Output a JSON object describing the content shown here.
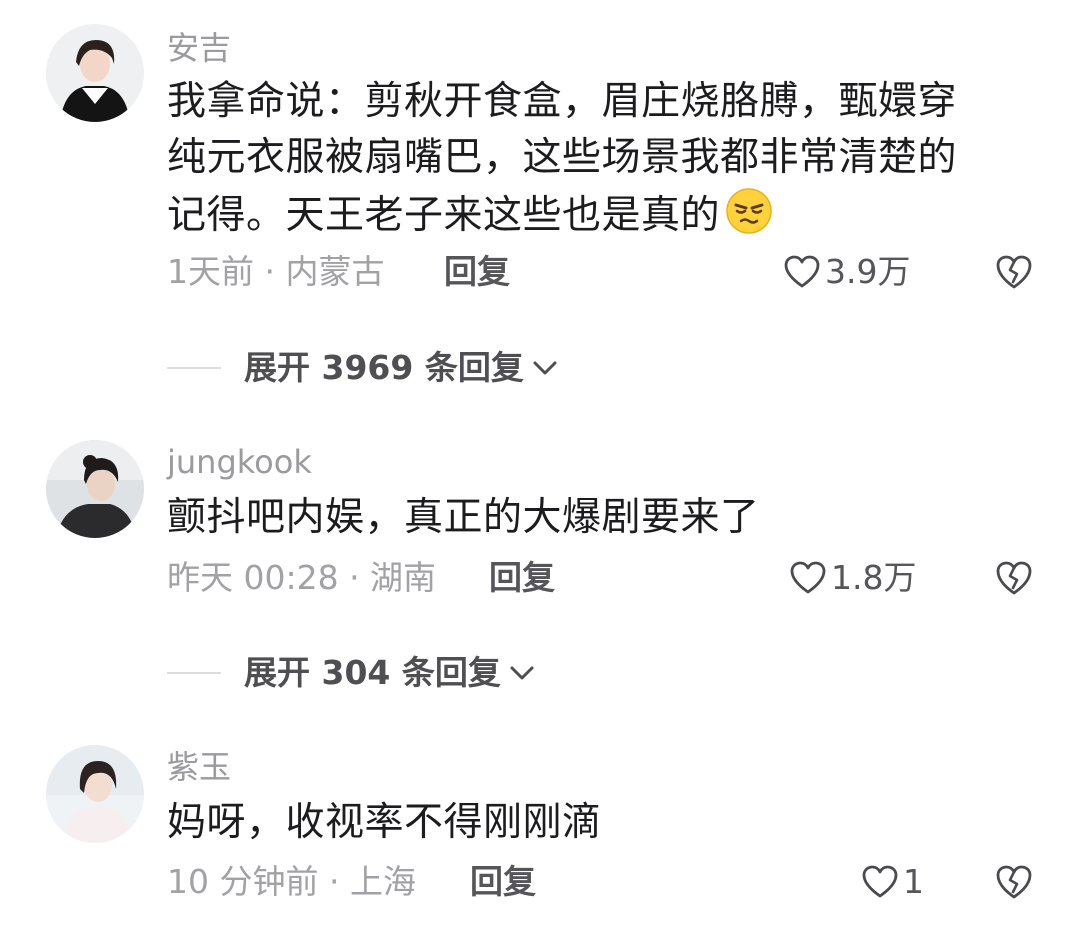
{
  "reply_label": "回复",
  "comments": [
    {
      "username": "安吉",
      "content_lines": [
        "我拿命说：剪秋开食盒，眉庄烧胳膊，甄嬛穿",
        "纯元衣服被扇嘴巴，这些场景我都非常清楚的",
        "记得。天王老子来这些也是真的"
      ],
      "emoji": "smirk-emoji",
      "meta": "1天前 · 内蒙古",
      "likes": "3.9万",
      "expand_label": "展开 3969 条回复"
    },
    {
      "username": "jungkook",
      "content_lines": [
        "颤抖吧内娱，真正的大爆剧要来了"
      ],
      "meta": "昨天 00:28 · 湖南",
      "likes": "1.8万",
      "expand_label": "展开 304 条回复"
    },
    {
      "username": "紫玉",
      "content_lines": [
        "妈呀，收视率不得刚刚滴"
      ],
      "meta": "10 分钟前 · 上海",
      "likes": "1"
    }
  ],
  "icons": {
    "like": "heart-outline-icon",
    "dislike": "broken-heart-icon",
    "expand": "chevron-down-icon"
  },
  "colors": {
    "text_primary": "#1c1c1e",
    "text_secondary": "#a2a2a6",
    "text_action": "#55555a"
  }
}
